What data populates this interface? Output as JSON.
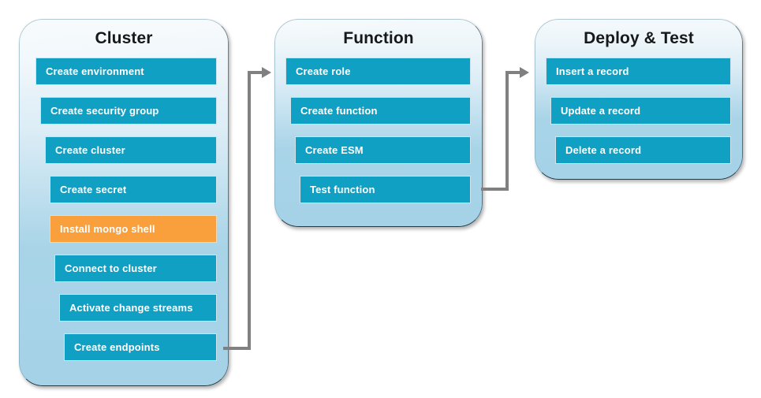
{
  "diagram": {
    "title_semantics": "aws-documentdb-lambda-tutorial-flow",
    "colors": {
      "step_blue": "#0fa0c4",
      "step_highlight_orange": "#f9a03c",
      "panel_top": "#f4f9fc",
      "panel_bottom": "#a5d2e7",
      "connector_gray": "#808080",
      "step_text": "#ffffff",
      "title_text": "#16181a"
    },
    "panels": [
      {
        "id": "cluster",
        "title": "Cluster",
        "steps": [
          {
            "label": "Create environment",
            "state": "normal"
          },
          {
            "label": "Create security group",
            "state": "normal"
          },
          {
            "label": "Create cluster",
            "state": "normal"
          },
          {
            "label": "Create secret",
            "state": "normal"
          },
          {
            "label": "Install mongo shell",
            "state": "highlight"
          },
          {
            "label": "Connect to cluster",
            "state": "normal"
          },
          {
            "label": "Activate change streams",
            "state": "normal"
          },
          {
            "label": "Create endpoints",
            "state": "normal"
          }
        ]
      },
      {
        "id": "function",
        "title": "Function",
        "steps": [
          {
            "label": "Create role",
            "state": "normal"
          },
          {
            "label": "Create function",
            "state": "normal"
          },
          {
            "label": "Create ESM",
            "state": "normal"
          },
          {
            "label": "Test function",
            "state": "normal"
          }
        ]
      },
      {
        "id": "deploy-test",
        "title": "Deploy & Test",
        "steps": [
          {
            "label": "Insert a record",
            "state": "normal"
          },
          {
            "label": "Update a record",
            "state": "normal"
          },
          {
            "label": "Delete a record",
            "state": "normal"
          }
        ]
      }
    ],
    "connectors": [
      {
        "id": "cluster-to-function",
        "from": "cluster",
        "to": "function"
      },
      {
        "id": "function-to-deploy-test",
        "from": "function",
        "to": "deploy-test"
      }
    ]
  }
}
